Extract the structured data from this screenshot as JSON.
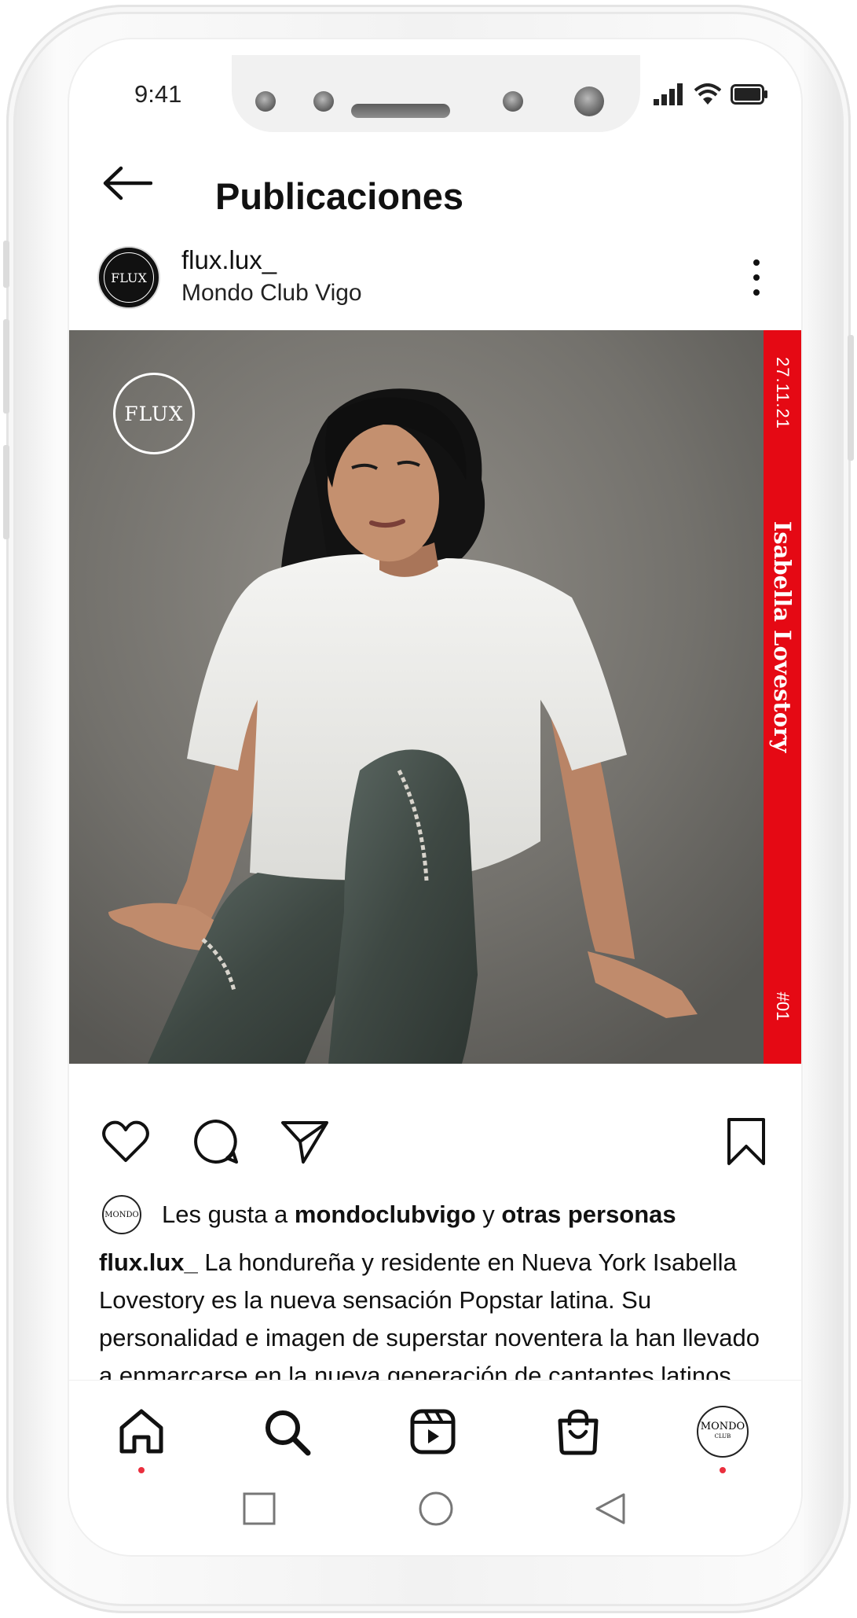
{
  "status_bar": {
    "time": "9:41"
  },
  "header": {
    "title": "Publicaciones"
  },
  "post": {
    "avatar_text": "FLUX",
    "username": "flux.lux_",
    "location": "Mondo Club Vigo",
    "image": {
      "badge": "FLUX",
      "strip_date": "27.11.21",
      "strip_name": "Isabella Lovestory",
      "strip_number": "#01",
      "strip_color": "#e50914"
    },
    "likes": {
      "avatar_text": "MONDO",
      "prefix": "Les gusta a ",
      "user": "mondoclubvigo",
      "connector": " y ",
      "others": "otras personas"
    },
    "caption": {
      "user": "flux.lux_",
      "text": " La hondureña y residente en Nueva York Isabella Lovestory es la nueva sensación Popstar latina. Su personalidad e imagen de superstar noventera la han llevado a enmarcarse en la nueva generación de cantantes latinos que están"
    }
  },
  "bottom_nav": {
    "items": [
      "home-icon",
      "search-icon",
      "reels-icon",
      "shop-icon",
      "profile-avatar"
    ],
    "profile_avatar_text": "MONDO",
    "profile_avatar_sub": "CLUB",
    "dot_color": "#ea2f3e"
  },
  "system_nav": [
    "recents-button",
    "home-button",
    "back-button"
  ]
}
